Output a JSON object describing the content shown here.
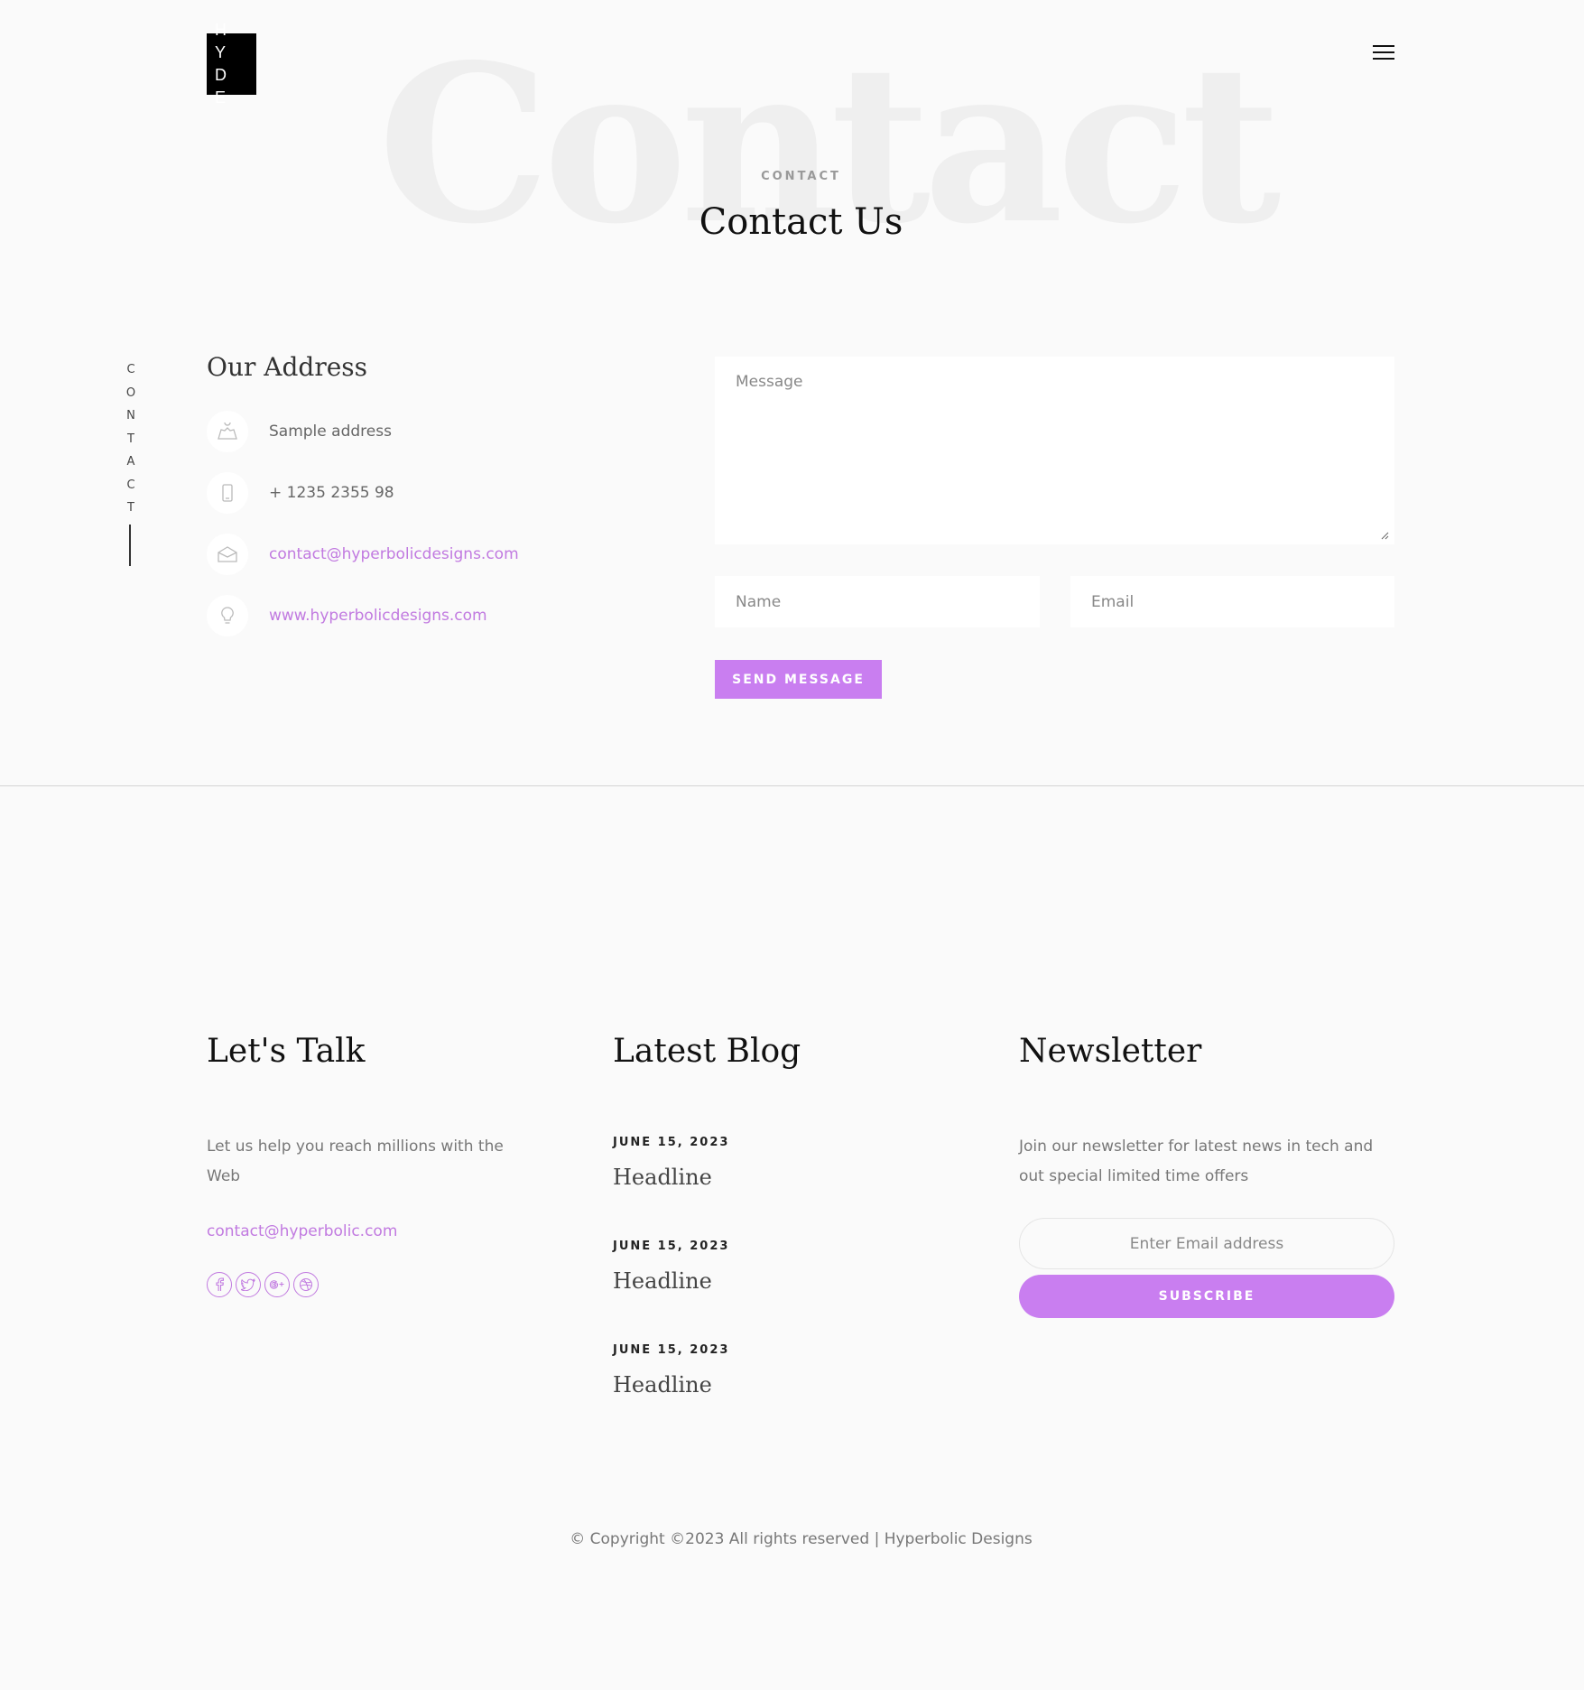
{
  "header": {
    "logo_line1": "H Y",
    "logo_line2": "D E",
    "bg_word": "Contact",
    "eyebrow": "CONTACT",
    "title": "Contact Us",
    "side_label_letters": [
      "C",
      "O",
      "N",
      "T",
      "A",
      "C",
      "T"
    ]
  },
  "address": {
    "title": "Our Address",
    "items": [
      {
        "icon": "map-icon",
        "text": "Sample address"
      },
      {
        "icon": "phone-icon",
        "text": "+ 1235 2355 98"
      },
      {
        "icon": "envelope-icon",
        "text": "contact@hyperbolicdesigns.com"
      },
      {
        "icon": "bulb-icon",
        "text": "www.hyperbolicdesigns.com"
      }
    ]
  },
  "form": {
    "message_placeholder": "Message",
    "name_placeholder": "Name",
    "email_placeholder": "Email",
    "send_label": "SEND MESSAGE"
  },
  "footer": {
    "talk": {
      "title": "Let's Talk",
      "text_line1": "Let us help you reach millions with the",
      "text_line2": "Web",
      "email": "contact@hyperbolic.com",
      "socials": [
        "facebook-icon",
        "twitter-icon",
        "google-plus-icon",
        "dribbble-icon"
      ]
    },
    "blog": {
      "title": "Latest Blog",
      "posts": [
        {
          "date": "JUNE 15, 2023",
          "headline": "Headline"
        },
        {
          "date": "JUNE 15, 2023",
          "headline": "Headline"
        },
        {
          "date": "JUNE 15, 2023",
          "headline": "Headline"
        }
      ]
    },
    "newsletter": {
      "title": "Newsletter",
      "text_line1": "Join our newsletter for latest news in tech and",
      "text_line2": "out special limited time offers",
      "email_placeholder": "Enter Email address",
      "subscribe_label": "SUBSCRIBE"
    },
    "copyright": "© Copyright ©2023 All rights reserved | Hyperbolic Designs"
  },
  "colors": {
    "accent": "#c97ef0",
    "link": "#c17ae0",
    "background": "#fafafa"
  }
}
